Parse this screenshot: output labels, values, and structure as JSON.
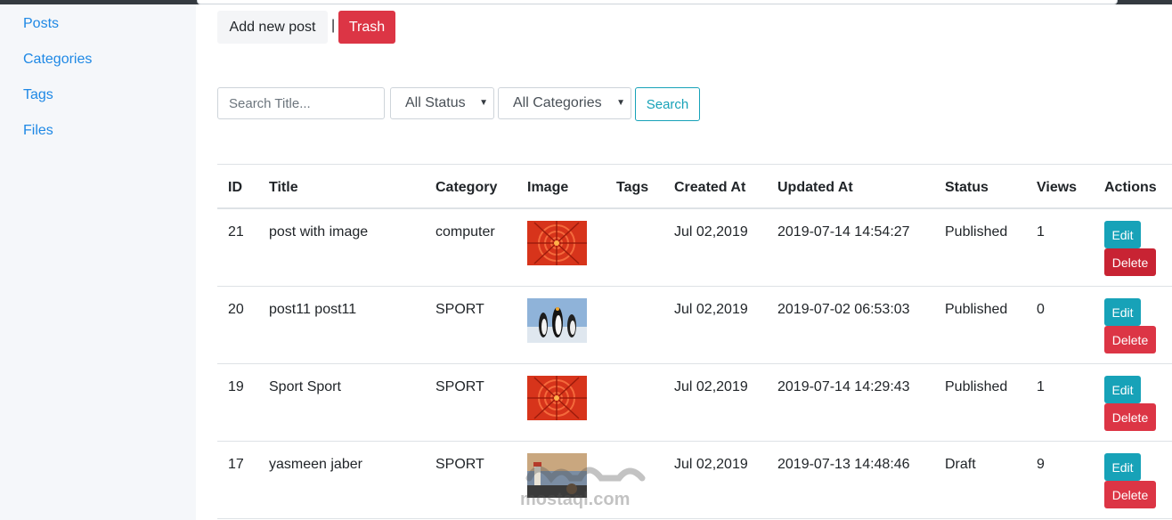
{
  "sidebar": {
    "items": [
      {
        "label": "Posts"
      },
      {
        "label": "Categories"
      },
      {
        "label": "Tags"
      },
      {
        "label": "Files"
      }
    ]
  },
  "toolbar": {
    "add_label": "Add new post",
    "separator": "|",
    "trash_label": "Trash"
  },
  "filters": {
    "search_placeholder": "Search Title...",
    "status_selected": "All Status",
    "category_selected": "All Categories",
    "search_label": "Search"
  },
  "table": {
    "headers": [
      "ID",
      "Title",
      "Category",
      "Image",
      "Tags",
      "Created At",
      "Updated At",
      "Status",
      "Views",
      "Actions"
    ],
    "rows": [
      {
        "id": "21",
        "title": "post with image",
        "category": "computer",
        "image": "flower",
        "tags": "",
        "created": "Jul 02,2019",
        "updated": "2019-07-14 14:54:27",
        "status": "Published",
        "views": "1"
      },
      {
        "id": "20",
        "title": "post11 post11",
        "category": "SPORT",
        "image": "penguins",
        "tags": "",
        "created": "Jul 02,2019",
        "updated": "2019-07-02 06:53:03",
        "status": "Published",
        "views": "0"
      },
      {
        "id": "19",
        "title": "Sport Sport",
        "category": "SPORT",
        "image": "flower",
        "tags": "",
        "created": "Jul 02,2019",
        "updated": "2019-07-14 14:29:43",
        "status": "Published",
        "views": "1"
      },
      {
        "id": "17",
        "title": "yasmeen jaber",
        "category": "SPORT",
        "image": "lighthouse",
        "tags": "",
        "created": "Jul 02,2019",
        "updated": "2019-07-13 14:48:46",
        "status": "Draft",
        "views": "9"
      }
    ],
    "edit_label": "Edit",
    "delete_label": "Delete"
  },
  "watermark": {
    "text": "mostaql.com"
  },
  "colors": {
    "primary_link": "#1e88e5",
    "danger": "#dc3545",
    "info": "#17a2b8"
  }
}
